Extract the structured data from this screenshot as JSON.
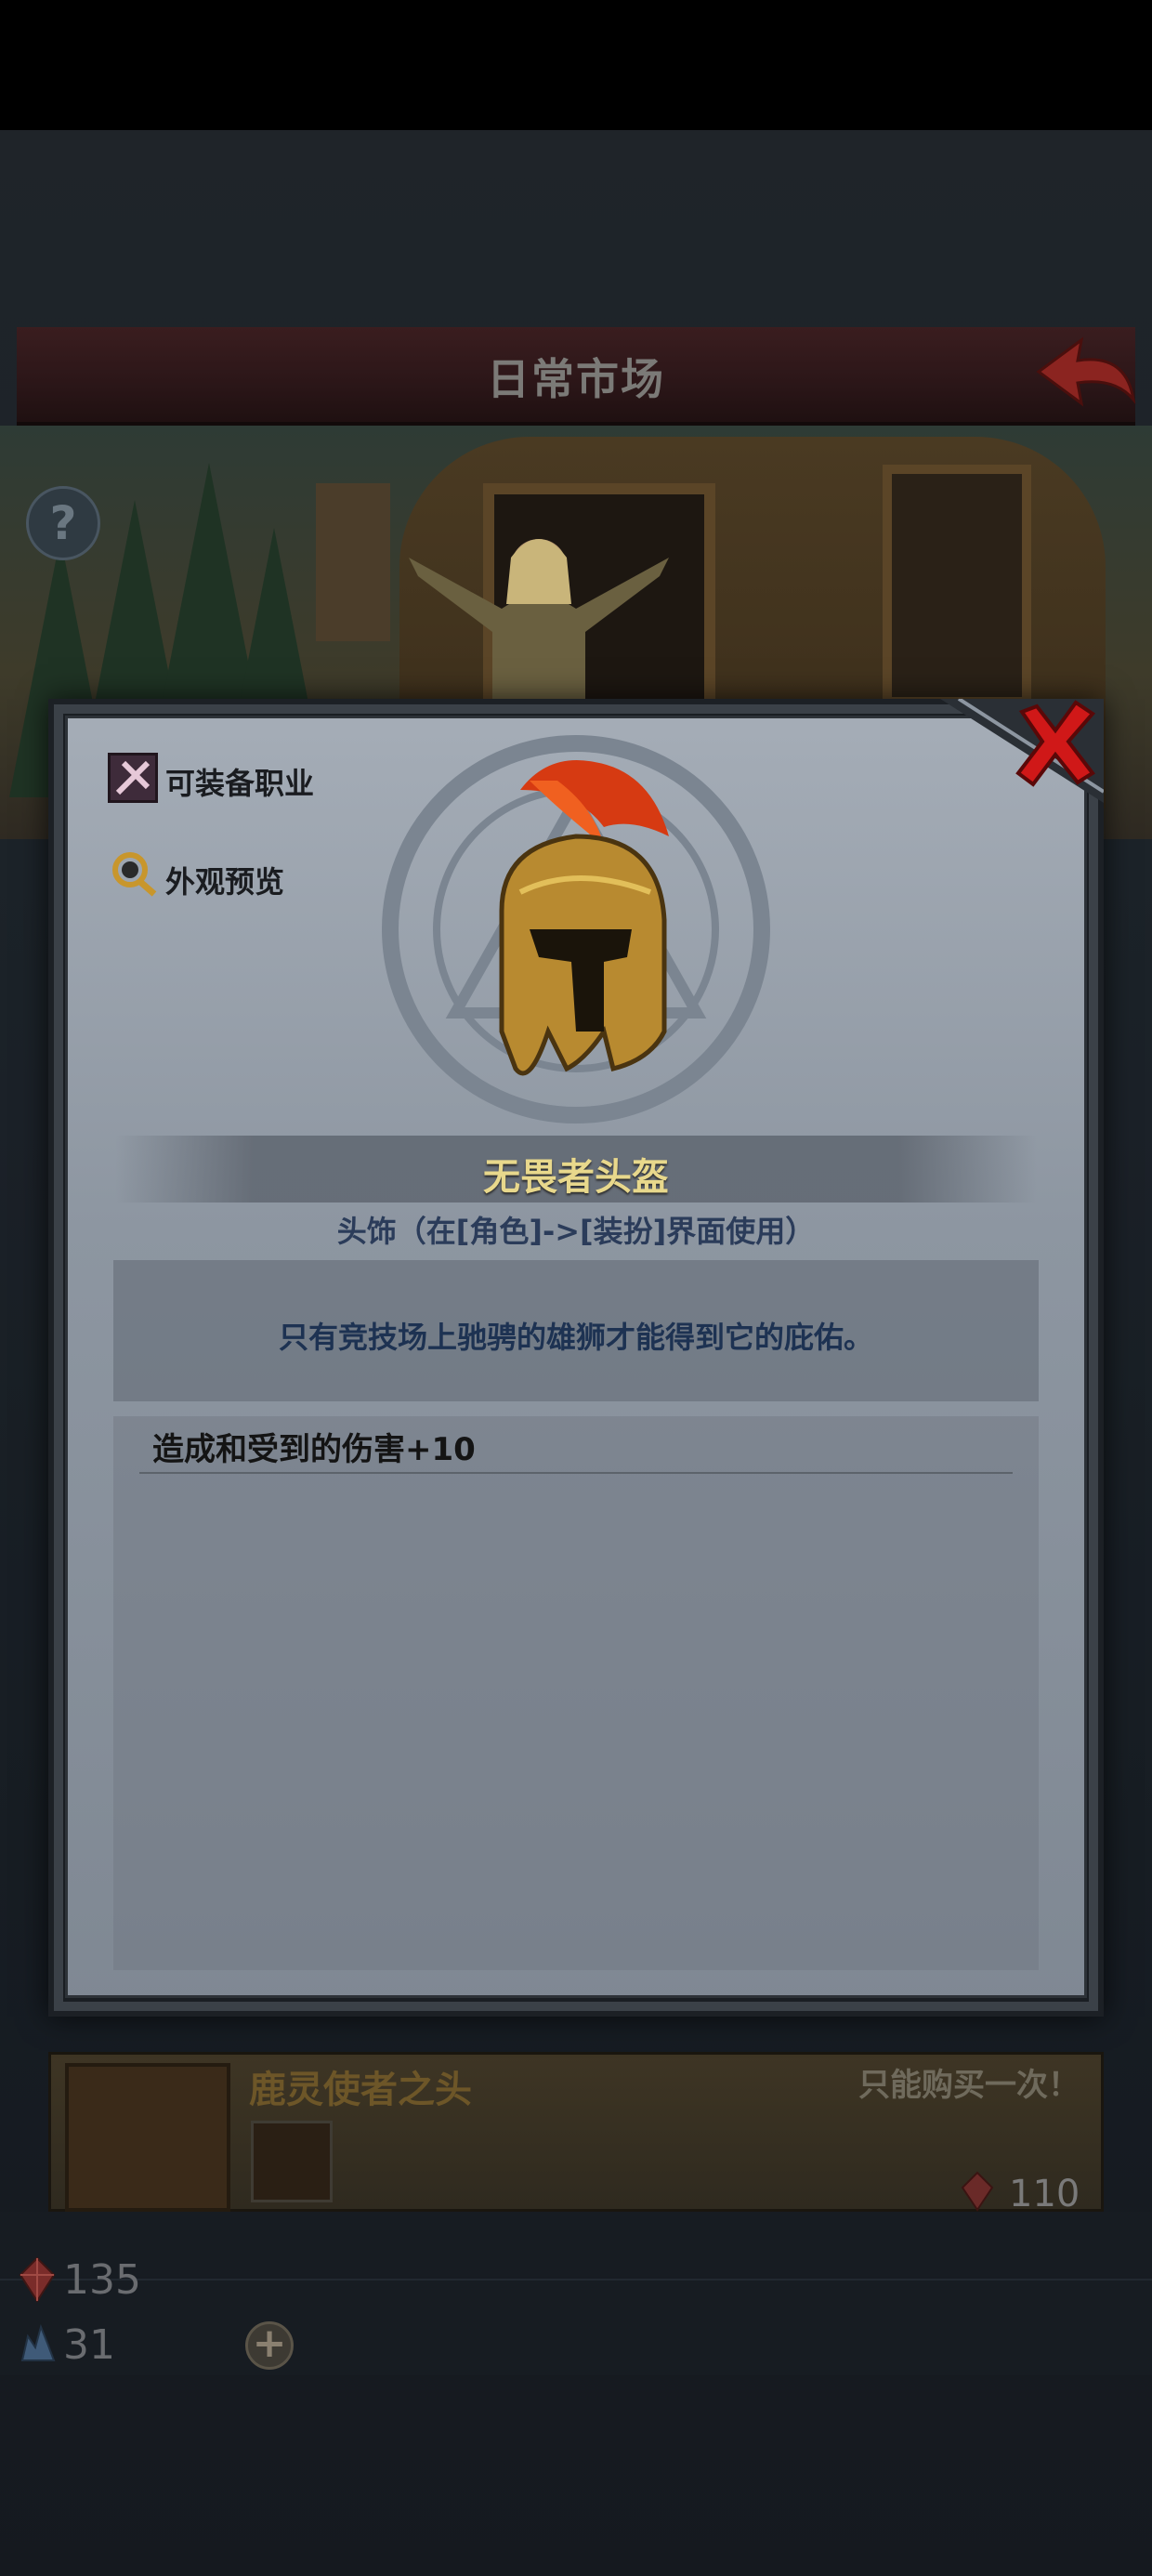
{
  "header": {
    "title": "日常市场"
  },
  "scene": {
    "help_label": "?"
  },
  "shop_card": {
    "title": "鹿灵使者之头",
    "purchase_limit": "只能购买一次！",
    "price": "110"
  },
  "currency": {
    "red_gems": "135",
    "blue_crystals": "31",
    "add_symbol": "+"
  },
  "modal": {
    "class_label": "可装备职业",
    "appearance_label": "外观预览",
    "item": {
      "name": "无畏者头盔",
      "type": "头饰（在[角色]->[装扮]界面使用）",
      "description": "只有竞技场上驰骋的雄狮才能得到它的庇佑。",
      "stats": [
        "造成和受到的伤害+10"
      ]
    }
  },
  "colors": {
    "item_name": "#e8d88c",
    "item_type": "#2b3c5a",
    "close_button": "#d01818",
    "panel_bg": "#8d96a1"
  },
  "icons": [
    "back-arrow-icon",
    "help-icon",
    "close-icon",
    "class-icon",
    "appearance-icon",
    "red-gem-icon",
    "blue-crystal-icon",
    "helmet-icon"
  ]
}
